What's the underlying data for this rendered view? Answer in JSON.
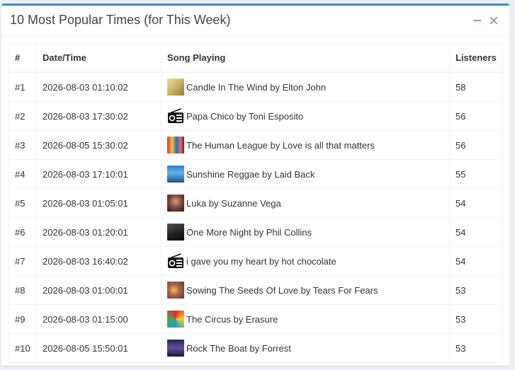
{
  "panel": {
    "title": "10 Most Popular Times (for This Week)",
    "minimize_icon": "minus-icon",
    "close_icon": "close-icon"
  },
  "table": {
    "headers": [
      "#",
      "Date/Time",
      "Song Playing",
      "Listeners"
    ],
    "rows": [
      {
        "rank": "#1",
        "datetime": "2026-08-03 01:10:02",
        "song": "Candle In The Wind by Elton John",
        "listeners": "58",
        "art": "album-art"
      },
      {
        "rank": "#2",
        "datetime": "2026-08-03 17:30:02",
        "song": "Papa Chico by Toni Esposito",
        "listeners": "56",
        "art": "radio-icon"
      },
      {
        "rank": "#3",
        "datetime": "2026-08-05 15:30:02",
        "song": "The Human League by Love is all that matters",
        "listeners": "56",
        "art": "album-art"
      },
      {
        "rank": "#4",
        "datetime": "2026-08-03 17:10:01",
        "song": "Sunshine Reggae by Laid Back",
        "listeners": "55",
        "art": "album-art"
      },
      {
        "rank": "#5",
        "datetime": "2026-08-03 01:05:01",
        "song": "Luka by Suzanne Vega",
        "listeners": "54",
        "art": "album-art"
      },
      {
        "rank": "#6",
        "datetime": "2026-08-03 01:20:01",
        "song": "One More Night by Phil Collins",
        "listeners": "54",
        "art": "album-art"
      },
      {
        "rank": "#7",
        "datetime": "2026-08-03 16:40:02",
        "song": "i gave you my heart by hot chocolate",
        "listeners": "54",
        "art": "radio-icon"
      },
      {
        "rank": "#8",
        "datetime": "2026-08-03 01:00:01",
        "song": "Sowing The Seeds Of Love by Tears For Fears",
        "listeners": "53",
        "art": "album-art"
      },
      {
        "rank": "#9",
        "datetime": "2026-08-03 01:15:00",
        "song": "The Circus by Erasure",
        "listeners": "53",
        "art": "album-art"
      },
      {
        "rank": "#10",
        "datetime": "2026-08-05 15:50:01",
        "song": "Rock The Boat by Forrest",
        "listeners": "53",
        "art": "album-art"
      }
    ]
  },
  "colors": {
    "accent": "#3c8dbc",
    "background": "#ecf0f5",
    "border": "#f4f4f4",
    "tool_icon": "#97a0b3"
  }
}
